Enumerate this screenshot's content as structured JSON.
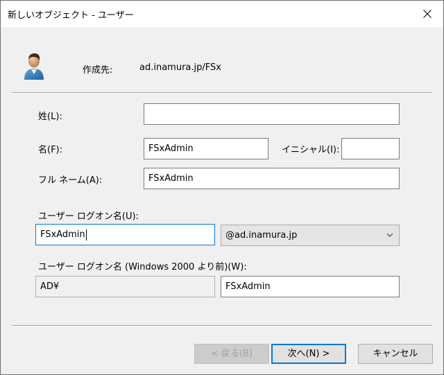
{
  "window": {
    "title": "新しいオブジェクト - ユーザー"
  },
  "icons": {
    "close": "close-icon",
    "user": "user-icon",
    "dropdown": "chevron-down-icon"
  },
  "destination": {
    "label": "作成先:",
    "value": "ad.inamura.jp/FSx"
  },
  "form": {
    "last_name": {
      "label": "姓(L):",
      "value": ""
    },
    "first_name": {
      "label": "名(F):",
      "value": "FSxAdmin"
    },
    "initials": {
      "label": "イニシャル(I):",
      "value": ""
    },
    "full_name": {
      "label": "フル ネーム(A):",
      "value": "FSxAdmin"
    },
    "logon_name": {
      "label": "ユーザー ログオン名(U):",
      "value": "FSxAdmin",
      "domain_selected": "@ad.inamura.jp"
    },
    "pre2000": {
      "label": "ユーザー ログオン名 (Windows 2000 より前)(W):",
      "domain_prefix": "AD¥",
      "value": "FSxAdmin"
    }
  },
  "buttons": {
    "back": "< 戻る(B)",
    "next": "次へ(N) >",
    "cancel": "キャンセル"
  },
  "colors": {
    "accent": "#0078d7",
    "dialog_bg": "#f0f0f0"
  }
}
